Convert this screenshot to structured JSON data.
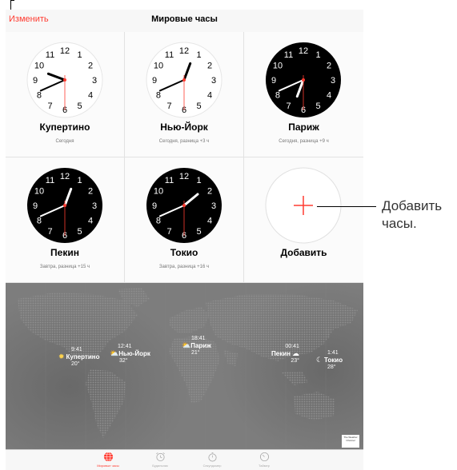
{
  "nav": {
    "edit_label": "Изменить",
    "title": "Мировые часы"
  },
  "clocks": [
    {
      "city": "Купертино",
      "subtitle": "Сегодня",
      "face": "light",
      "hour": 9,
      "minute": 41,
      "second": 30
    },
    {
      "city": "Нью-Йорк",
      "subtitle": "Сегодня, разница +3 ч",
      "face": "light",
      "hour": 12,
      "minute": 41,
      "second": 30
    },
    {
      "city": "Париж",
      "subtitle": "Сегодня, разница +9 ч",
      "face": "dark",
      "hour": 6,
      "minute": 41,
      "second": 30
    },
    {
      "city": "Пекин",
      "subtitle": "Завтра, разница +15 ч",
      "face": "dark",
      "hour": 12,
      "minute": 41,
      "second": 30
    },
    {
      "city": "Токио",
      "subtitle": "Завтра, разница +16 ч",
      "face": "dark",
      "hour": 1,
      "minute": 41,
      "second": 30
    }
  ],
  "add_clock": {
    "label": "Добавить",
    "icon": "plus-icon"
  },
  "map_markers": [
    {
      "time": "9:41",
      "city": "Купертино",
      "temp": "20°",
      "weather_icon": "sun-icon"
    },
    {
      "time": "12:41",
      "city": "Нью-Йорк",
      "temp": "32°",
      "weather_icon": "partly-cloudy-icon"
    },
    {
      "time": "18:41",
      "city": "Париж",
      "temp": "21°",
      "weather_icon": "partly-cloudy-icon"
    },
    {
      "time": "00:41",
      "city": "Пекин",
      "temp": "23°",
      "weather_icon": "cloud-icon"
    },
    {
      "time": "1:41",
      "city": "Токио",
      "temp": "28°",
      "weather_icon": "moon-icon"
    }
  ],
  "weather_logo": "The Weather Channel",
  "tabs": [
    {
      "label": "Мировые часы",
      "icon": "globe-icon",
      "active": true
    },
    {
      "label": "Будильник",
      "icon": "alarm-clock-icon",
      "active": false
    },
    {
      "label": "Секундомер",
      "icon": "stopwatch-icon",
      "active": false
    },
    {
      "label": "Таймер",
      "icon": "timer-icon",
      "active": false
    }
  ],
  "callout_text": "Добавить часы.",
  "colors": {
    "accent": "#ff3b30",
    "map": "#7a7a7a",
    "land": "#5a5a5a"
  }
}
